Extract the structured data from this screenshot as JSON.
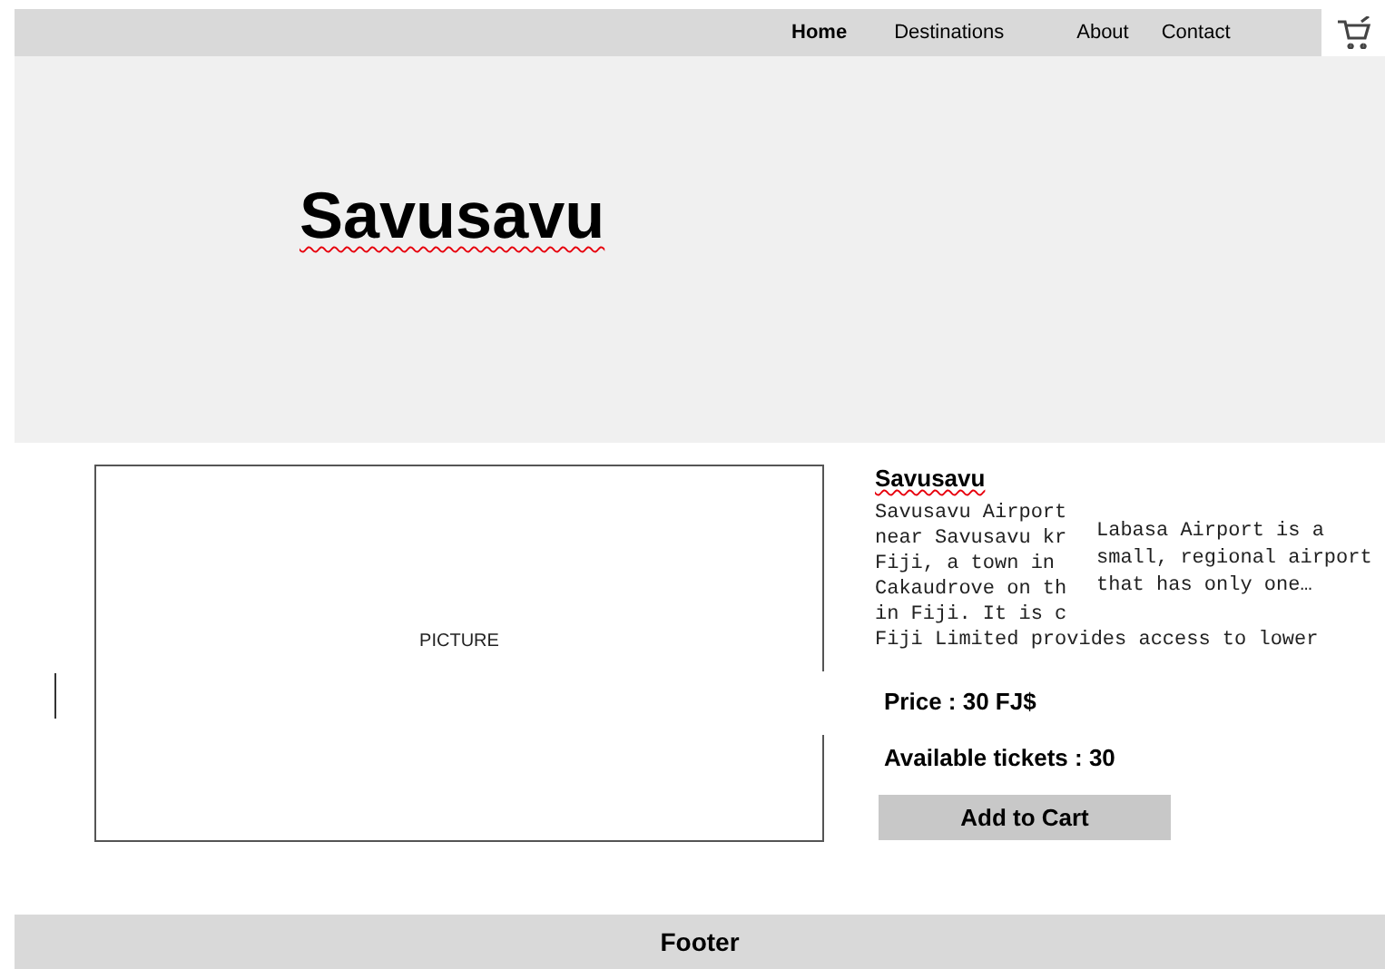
{
  "nav": {
    "items": [
      {
        "label": "Home",
        "selected": true
      },
      {
        "label": "Destinations",
        "selected": false
      },
      {
        "label": "About",
        "selected": false
      },
      {
        "label": "Contact",
        "selected": false
      }
    ]
  },
  "hero": {
    "title": "Savusavu"
  },
  "picture_placeholder": {
    "label": "PICTURE"
  },
  "details": {
    "title": "Savusavu",
    "description_lines": [
      "Savusavu Airport",
      "near Savusavu kr",
      "Fiji, a town in",
      "Cakaudrove on th",
      "in Fiji. It is c",
      "Fiji Limited provides access to lower"
    ],
    "tooltip_lines": [
      "Labasa Airport is a",
      "small, regional airport",
      "that has only one…"
    ],
    "price": "Price : 30 FJ$",
    "tickets": "Available tickets : 30",
    "button": "Add to Cart"
  },
  "footer": {
    "label": "Footer"
  }
}
